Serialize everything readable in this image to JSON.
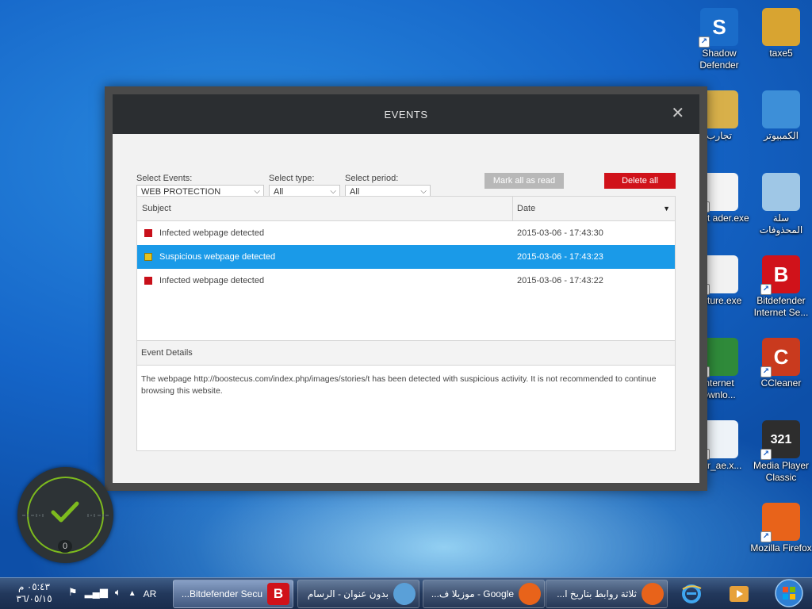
{
  "desktop": {
    "icons": [
      {
        "id": "shadow-defender",
        "label": "Shadow Defender",
        "color": "#1a6cc9",
        "glyph": "S"
      },
      {
        "id": "taxe5",
        "label": "taxe5",
        "color": "#d8a431",
        "glyph": ""
      },
      {
        "id": "tajareb",
        "label": "تجارب",
        "color": "#d8b04a",
        "glyph": ""
      },
      {
        "id": "computer",
        "label": "الكمبيوتر",
        "color": "#3d8fd8",
        "glyph": ""
      },
      {
        "id": "foxit",
        "label": "Foxit ader.exe",
        "color": "#f4f4f4",
        "glyph": ""
      },
      {
        "id": "recycle",
        "label": "سلة المحذوفات",
        "color": "#9fc7e6",
        "glyph": ""
      },
      {
        "id": "capture",
        "label": "apture.exe",
        "color": "#f2f2f2",
        "glyph": ""
      },
      {
        "id": "bitdefender",
        "label": "Bitdefender Internet Se...",
        "color": "#d0121a",
        "glyph": "B"
      },
      {
        "id": "idm",
        "label": "nternet ownlo...",
        "color": "#2f8a3a",
        "glyph": ""
      },
      {
        "id": "ccleaner",
        "label": "CCleaner",
        "color": "#c93a1e",
        "glyph": "C"
      },
      {
        "id": "ar-ae",
        "label": "_ar_ae.x...",
        "color": "#eef3f8",
        "glyph": ""
      },
      {
        "id": "mpc",
        "label": "Media Player Classic",
        "color": "#2d2d2d",
        "glyph": "321"
      },
      {
        "id": "firefox",
        "label": "Mozilla Firefox",
        "color": "#e8631a",
        "glyph": ""
      }
    ]
  },
  "dialog": {
    "title": "EVENTS",
    "close_icon": "close-icon",
    "filters": {
      "events_label": "Select Events:",
      "events_value": "WEB PROTECTION",
      "type_label": "Select type:",
      "type_value": "All",
      "period_label": "Select period:",
      "period_value": "All"
    },
    "mark_all_label": "Mark all as read",
    "delete_all_label": "Delete all",
    "table": {
      "col_subject": "Subject",
      "col_date": "Date",
      "rows": [
        {
          "subject": "Infected webpage detected",
          "date": "2015-03-06 - 17:43:30",
          "severity_color": "#c8101a"
        },
        {
          "subject": "Suspicious webpage detected",
          "date": "2015-03-06 - 17:43:23",
          "severity_color": "#e5c21c"
        },
        {
          "subject": "Infected webpage detected",
          "date": "2015-03-06 - 17:43:22",
          "severity_color": "#c8101a"
        }
      ]
    },
    "details": {
      "header": "Event Details",
      "text": "The webpage http://boostecus.com/index.php/images/stories/t has been detected with suspicious activity. It is not recommended to continue browsing this website."
    }
  },
  "widget": {
    "count": "0",
    "accent": "#7dbb1e"
  },
  "taskbar": {
    "time": "٠٥:٤٣ م",
    "date": "٣٦/٠٥/١٥",
    "lang": "AR",
    "items": [
      {
        "title": "Bitdefender Secu...",
        "icon_color": "#d0121a",
        "glyph": "B"
      },
      {
        "title": "بدون عنوان - الرسام",
        "icon_color": "#5aa0d8",
        "glyph": ""
      },
      {
        "title": "Google - موزيلا ف...",
        "icon_color": "#e8631a",
        "glyph": ""
      },
      {
        "title": "ثلاثة روابط بتاريخ ا...",
        "icon_color": "#e8631a",
        "glyph": ""
      }
    ]
  }
}
